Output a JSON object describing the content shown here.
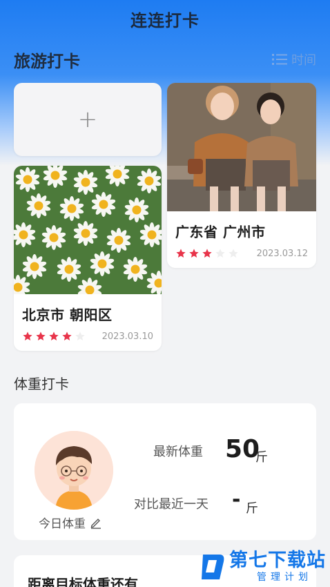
{
  "header": {
    "title": "连连打卡"
  },
  "travel": {
    "section_title": "旅游打卡",
    "sort_label": "时间",
    "add_label": "+",
    "cards": [
      {
        "title": "广东省 广州市",
        "rating": 3,
        "max_rating": 5,
        "date": "2023.03.12",
        "image": "two-girls-photo"
      },
      {
        "title": "北京市 朝阳区",
        "rating": 4,
        "max_rating": 5,
        "date": "2023.03.10",
        "image": "daisy-flowers-photo"
      }
    ]
  },
  "weight": {
    "section_title": "体重打卡",
    "latest_label": "最新体重",
    "latest_value": "50",
    "latest_unit": "斤",
    "compare_label": "对比最近一天",
    "compare_value": "-",
    "compare_unit": "斤",
    "today_label": "今日体重"
  },
  "goal": {
    "title": "距离目标体重还有"
  },
  "watermark": {
    "main": "第七下载站",
    "sub": "管理计划"
  },
  "colors": {
    "primary": "#1e7cf2",
    "star_active": "#e8344a",
    "star_inactive": "#eeeeee"
  }
}
